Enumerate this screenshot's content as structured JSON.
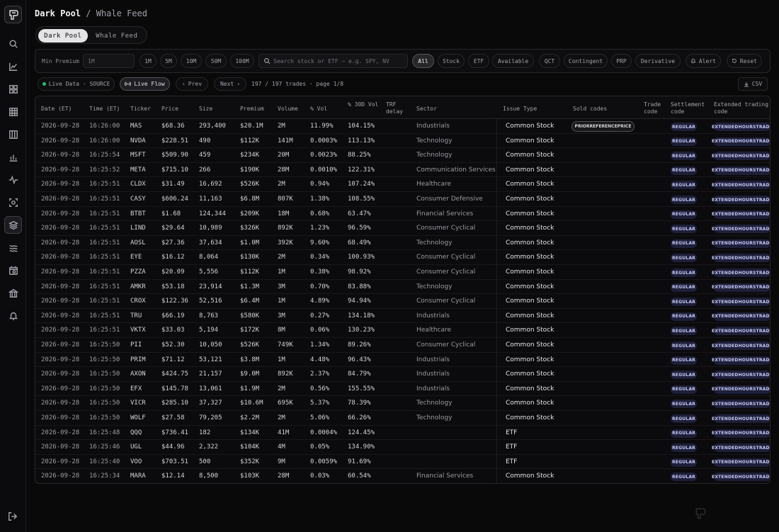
{
  "header": {
    "section": "Dark Pool",
    "separator": "/",
    "page": "Whale Feed"
  },
  "tabs": [
    {
      "label": "Dark Pool",
      "active": true
    },
    {
      "label": "Whale Feed",
      "active": false
    }
  ],
  "filters": {
    "min_premium_label": "Min Premium",
    "min_premium_placeholder": "1M",
    "premium_presets": [
      "1M",
      "5M",
      "10M",
      "50M",
      "100M"
    ],
    "search_placeholder": "Search stock or ETF — e.g. SPY, NV",
    "type_filters": [
      "All",
      "Stock",
      "ETF",
      "Available",
      "QCT",
      "Contingent",
      "PRP",
      "Derivative"
    ],
    "selected_type": "All",
    "alert_label": "Alert",
    "reset_label": "Reset"
  },
  "toolbar": {
    "live_data_label": "Live Data · SOURCE",
    "live_flow_label": "Live Flow",
    "prev_label": "Prev",
    "next_label": "Next",
    "count_text": "197 / 197 trades · page 1/8",
    "csv_label": "CSV"
  },
  "table": {
    "columns": [
      "Date (ET)",
      "Time (ET)",
      "Ticker",
      "Price",
      "Size",
      "Premium",
      "Volume",
      "% Vol",
      "% 30D Vol",
      "TRF delay",
      "Sector",
      "Issue Type",
      "Sold codes",
      "Trade code",
      "Settlement code",
      "Extended trading code"
    ],
    "rows": [
      [
        "2026-09-28",
        "16:26:00",
        "MAS",
        "$68.36",
        "293,400",
        "$20.1M",
        "2M",
        "11.99%",
        "104.15%",
        "Industrials",
        "Common Stock",
        "PRIORREFERENCEPRICE",
        "REGULAR",
        "EXTENDEDHOURSTRADE"
      ],
      [
        "2026-09-28",
        "16:26:00",
        "NVDA",
        "$228.51",
        "490",
        "$112K",
        "141M",
        "0.0003%",
        "113.13%",
        "Technology",
        "Common Stock",
        "",
        "REGULAR",
        "EXTENDEDHOURSTRADE"
      ],
      [
        "2026-09-28",
        "16:25:54",
        "MSFT",
        "$509.90",
        "459",
        "$234K",
        "20M",
        "0.0023%",
        "88.25%",
        "Technology",
        "Common Stock",
        "",
        "REGULAR",
        "EXTENDEDHOURSTRADE"
      ],
      [
        "2026-09-28",
        "16:25:52",
        "META",
        "$715.10",
        "266",
        "$190K",
        "28M",
        "0.0010%",
        "122.31%",
        "Communication Services",
        "Common Stock",
        "",
        "REGULAR",
        "EXTENDEDHOURSTRADE"
      ],
      [
        "2026-09-28",
        "16:25:51",
        "CLDX",
        "$31.49",
        "16,692",
        "$526K",
        "2M",
        "0.94%",
        "107.24%",
        "Healthcare",
        "Common Stock",
        "",
        "REGULAR",
        "EXTENDEDHOURSTRADE"
      ],
      [
        "2026-09-28",
        "16:25:51",
        "CASY",
        "$606.24",
        "11,163",
        "$6.8M",
        "807K",
        "1.38%",
        "108.55%",
        "Consumer Defensive",
        "Common Stock",
        "",
        "REGULAR",
        "EXTENDEDHOURSTRADE"
      ],
      [
        "2026-09-28",
        "16:25:51",
        "BTBT",
        "$1.68",
        "124,344",
        "$209K",
        "18M",
        "0.68%",
        "63.47%",
        "Financial Services",
        "Common Stock",
        "",
        "REGULAR",
        "EXTENDEDHOURSTRADE"
      ],
      [
        "2026-09-28",
        "16:25:51",
        "LIND",
        "$29.64",
        "10,989",
        "$326K",
        "892K",
        "1.23%",
        "96.59%",
        "Consumer Cyclical",
        "Common Stock",
        "",
        "REGULAR",
        "EXTENDEDHOURSTRADE"
      ],
      [
        "2026-09-28",
        "16:25:51",
        "AOSL",
        "$27.36",
        "37,634",
        "$1.0M",
        "392K",
        "9.60%",
        "68.49%",
        "Technology",
        "Common Stock",
        "",
        "REGULAR",
        "EXTENDEDHOURSTRADE"
      ],
      [
        "2026-09-28",
        "16:25:51",
        "EYE",
        "$16.12",
        "8,064",
        "$130K",
        "2M",
        "0.34%",
        "100.93%",
        "Consumer Cyclical",
        "Common Stock",
        "",
        "REGULAR",
        "EXTENDEDHOURSTRADE"
      ],
      [
        "2026-09-28",
        "16:25:51",
        "PZZA",
        "$20.09",
        "5,556",
        "$112K",
        "1M",
        "0.38%",
        "98.92%",
        "Consumer Cyclical",
        "Common Stock",
        "",
        "REGULAR",
        "EXTENDEDHOURSTRADE"
      ],
      [
        "2026-09-28",
        "16:25:51",
        "AMKR",
        "$53.18",
        "23,914",
        "$1.3M",
        "3M",
        "0.70%",
        "83.88%",
        "Technology",
        "Common Stock",
        "",
        "REGULAR",
        "EXTENDEDHOURSTRADE"
      ],
      [
        "2026-09-28",
        "16:25:51",
        "CROX",
        "$122.36",
        "52,516",
        "$6.4M",
        "1M",
        "4.89%",
        "94.94%",
        "Consumer Cyclical",
        "Common Stock",
        "",
        "REGULAR",
        "EXTENDEDHOURSTRADE"
      ],
      [
        "2026-09-28",
        "16:25:51",
        "TRU",
        "$66.19",
        "8,763",
        "$580K",
        "3M",
        "0.27%",
        "134.18%",
        "Industrials",
        "Common Stock",
        "",
        "REGULAR",
        "EXTENDEDHOURSTRADE"
      ],
      [
        "2026-09-28",
        "16:25:51",
        "VKTX",
        "$33.03",
        "5,194",
        "$172K",
        "8M",
        "0.06%",
        "130.23%",
        "Healthcare",
        "Common Stock",
        "",
        "REGULAR",
        "EXTENDEDHOURSTRADE"
      ],
      [
        "2026-09-28",
        "16:25:50",
        "PII",
        "$52.30",
        "10,050",
        "$526K",
        "749K",
        "1.34%",
        "89.26%",
        "Consumer Cyclical",
        "Common Stock",
        "",
        "REGULAR",
        "EXTENDEDHOURSTRADE"
      ],
      [
        "2026-09-28",
        "16:25:50",
        "PRIM",
        "$71.12",
        "53,121",
        "$3.8M",
        "1M",
        "4.48%",
        "96.43%",
        "Industrials",
        "Common Stock",
        "",
        "REGULAR",
        "EXTENDEDHOURSTRADE"
      ],
      [
        "2026-09-28",
        "16:25:50",
        "AXON",
        "$424.75",
        "21,157",
        "$9.0M",
        "892K",
        "2.37%",
        "84.79%",
        "Industrials",
        "Common Stock",
        "",
        "REGULAR",
        "EXTENDEDHOURSTRADE"
      ],
      [
        "2026-09-28",
        "16:25:50",
        "EFX",
        "$145.78",
        "13,061",
        "$1.9M",
        "2M",
        "0.56%",
        "155.55%",
        "Industrials",
        "Common Stock",
        "",
        "REGULAR",
        "EXTENDEDHOURSTRADE"
      ],
      [
        "2026-09-28",
        "16:25:50",
        "VICR",
        "$285.10",
        "37,327",
        "$10.6M",
        "695K",
        "5.37%",
        "78.39%",
        "Technology",
        "Common Stock",
        "",
        "REGULAR",
        "EXTENDEDHOURSTRADE"
      ],
      [
        "2026-09-28",
        "16:25:50",
        "WOLF",
        "$27.58",
        "79,205",
        "$2.2M",
        "2M",
        "5.06%",
        "66.26%",
        "Technology",
        "Common Stock",
        "",
        "REGULAR",
        "EXTENDEDHOURSTRADE"
      ],
      [
        "2026-09-28",
        "16:25:48",
        "QQQ",
        "$736.41",
        "182",
        "$134K",
        "41M",
        "0.0004%",
        "124.45%",
        "",
        "ETF",
        "",
        "REGULAR",
        "EXTENDEDHOURSTRADE"
      ],
      [
        "2026-09-28",
        "16:25:46",
        "UGL",
        "$44.96",
        "2,322",
        "$104K",
        "4M",
        "0.05%",
        "134.90%",
        "",
        "ETF",
        "",
        "REGULAR",
        "EXTENDEDHOURSTRADE"
      ],
      [
        "2026-09-28",
        "16:25:40",
        "VOO",
        "$703.51",
        "500",
        "$352K",
        "9M",
        "0.0059%",
        "91.69%",
        "",
        "ETF",
        "",
        "REGULAR",
        "EXTENDEDHOURSTRADE"
      ],
      [
        "2026-09-28",
        "16:25:34",
        "MARA",
        "$12.14",
        "8,500",
        "$103K",
        "28M",
        "0.03%",
        "60.54%",
        "Financial Services",
        "Common Stock",
        "",
        "REGULAR",
        "EXTENDEDHOURSTRADE"
      ]
    ]
  }
}
